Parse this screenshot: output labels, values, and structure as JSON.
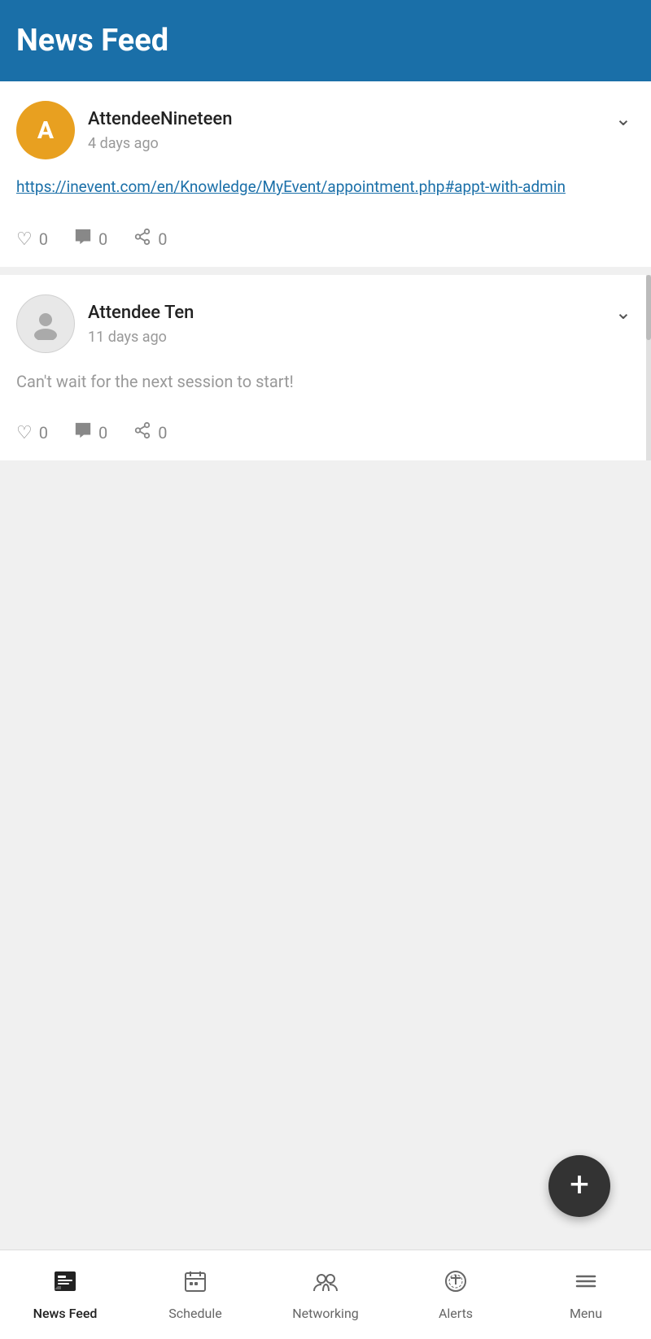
{
  "header": {
    "title": "News Feed"
  },
  "posts": [
    {
      "id": "post1",
      "username": "AttendeeNineteen",
      "avatar_letter": "A",
      "avatar_type": "gold",
      "time_ago": "4 days ago",
      "content_type": "link",
      "content": "https://inevent.com/en/Knowledge/MyEvent/appointment.php#appt-with-admin",
      "likes": 0,
      "comments": 0,
      "shares": 0
    },
    {
      "id": "post2",
      "username": "Attendee Ten",
      "avatar_letter": "",
      "avatar_type": "person",
      "time_ago": "11 days ago",
      "content_type": "text",
      "content": "Can't wait for the next session to start!",
      "likes": 0,
      "comments": 0,
      "shares": 0
    }
  ],
  "fab": {
    "label": "+"
  },
  "bottom_nav": {
    "items": [
      {
        "id": "news-feed",
        "label": "News Feed",
        "icon": "news",
        "active": true
      },
      {
        "id": "schedule",
        "label": "Schedule",
        "icon": "schedule",
        "active": false
      },
      {
        "id": "networking",
        "label": "Networking",
        "icon": "networking",
        "active": false
      },
      {
        "id": "alerts",
        "label": "Alerts",
        "icon": "alerts",
        "active": false
      },
      {
        "id": "menu",
        "label": "Menu",
        "icon": "menu",
        "active": false
      }
    ]
  }
}
